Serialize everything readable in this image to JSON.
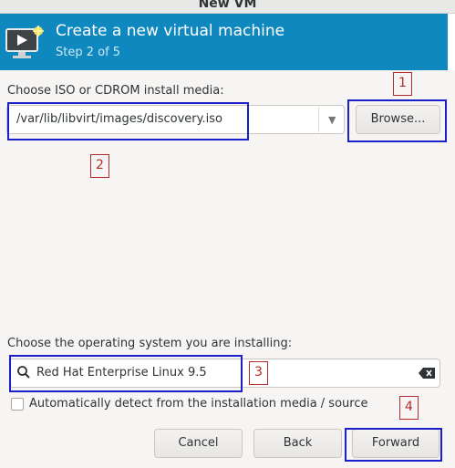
{
  "window": {
    "title": "New VM"
  },
  "header": {
    "title": "Create a new virtual machine",
    "step": "Step 2 of 5"
  },
  "media": {
    "label": "Choose ISO or CDROM install media:",
    "path": "/var/lib/libvirt/images/discovery.iso",
    "browse_label": "Browse..."
  },
  "os": {
    "label": "Choose the operating system you are installing:",
    "search_value": "Red Hat Enterprise Linux 9.5",
    "auto_detect_label": "Automatically detect from the installation media / source",
    "auto_detect_checked": false
  },
  "buttons": {
    "cancel": "Cancel",
    "back": "Back",
    "forward": "Forward"
  },
  "annotations": {
    "n1": "1",
    "n2": "2",
    "n3": "3",
    "n4": "4"
  },
  "colors": {
    "header": "#0f88bf",
    "annotation_box": "#1a1fc9",
    "annotation_number": "#b52a2a"
  }
}
